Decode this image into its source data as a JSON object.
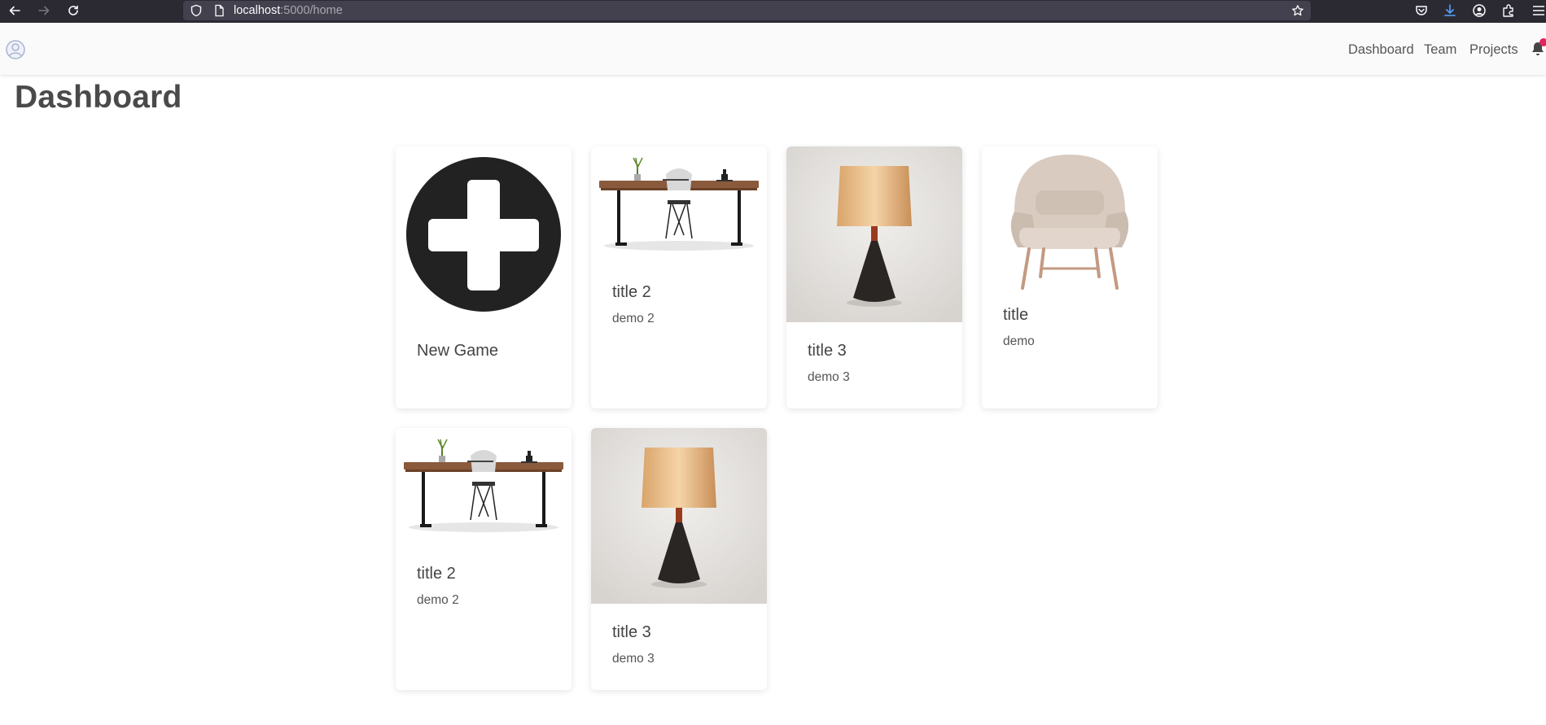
{
  "browser": {
    "url_host": "localhost",
    "url_rest": ":5000/home"
  },
  "navbar": {
    "links": [
      "Dashboard",
      "Team",
      "Projects"
    ]
  },
  "page": {
    "title": "Dashboard"
  },
  "cards": [
    {
      "image": "plus-circle-icon",
      "title": "New Game",
      "text": ""
    },
    {
      "image": "desk-image",
      "title": "title 2",
      "text": "demo 2"
    },
    {
      "image": "lamp-image",
      "title": "title 3",
      "text": "demo 3"
    },
    {
      "image": "armchair-image",
      "title": "title",
      "text": "demo"
    },
    {
      "image": "desk-image",
      "title": "title 2",
      "text": "demo 2"
    },
    {
      "image": "lamp-image",
      "title": "title 3",
      "text": "demo 3"
    }
  ],
  "colors": {
    "browser_bg": "#2b2a33",
    "url_field_bg": "#42414d",
    "navbar_bg": "#fafafa",
    "notification_badge": "#e0245e",
    "text_primary": "#444444"
  }
}
